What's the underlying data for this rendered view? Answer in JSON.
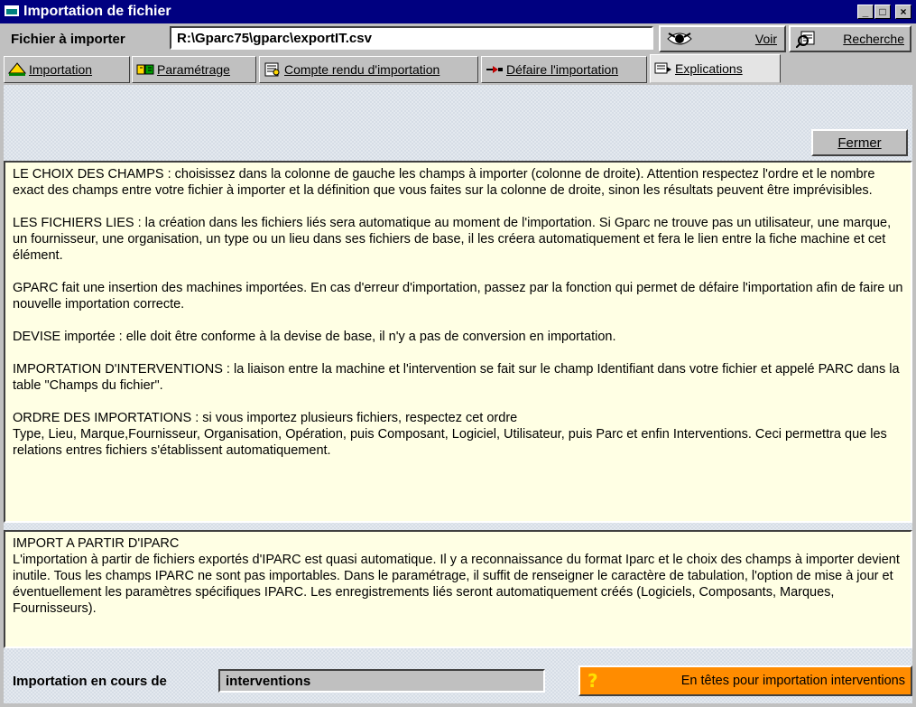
{
  "window": {
    "title": "Importation de fichier",
    "minimize": "_",
    "maximize": "□",
    "close": "×"
  },
  "file": {
    "label": "Fichier à importer",
    "value": "R:\\Gparc75\\gparc\\exportIT.csv",
    "view_button": "Voir",
    "search_button": "Recherche"
  },
  "tabs": [
    {
      "label": "Importation",
      "icon": "import-icon"
    },
    {
      "label": "Paramétrage",
      "icon": "settings-icon"
    },
    {
      "label": "Compte rendu d'importation",
      "icon": "report-icon"
    },
    {
      "label": "Défaire l'importation",
      "icon": "undo-icon"
    },
    {
      "label": "Explications",
      "icon": "help-icon",
      "active": true
    }
  ],
  "close_button": "Fermer",
  "explanations": [
    "LE CHOIX DES CHAMPS : choisissez dans la colonne de gauche les champs à importer (colonne de droite). Attention respectez l'ordre et le nombre exact des champs entre votre fichier à importer et la définition que vous faites sur la colonne de droite, sinon les résultats peuvent être imprévisibles.",
    "LES FICHIERS LIES : la création dans les fichiers liés sera automatique au moment de l'importation. Si Gparc ne trouve pas un utilisateur, une marque, un fournisseur, une organisation, un type ou un lieu dans ses fichiers de base, il les créera automatiquement et fera le lien entre la fiche machine et cet élément.",
    "GPARC fait une insertion des machines importées. En cas d'erreur d'importation, passez par la fonction qui permet de défaire l'importation afin de faire un nouvelle importation correcte.",
    "DEVISE importée : elle doit être conforme à la devise de base, il n'y a pas de conversion en importation.",
    "IMPORTATION D'INTERVENTIONS : la liaison entre la machine et l'intervention se fait sur le champ Identifiant dans votre fichier et appelé PARC dans la table \"Champs du fichier\".",
    "ORDRE DES IMPORTATIONS : si vous importez plusieurs fichiers, respectez cet ordre\nType, Lieu, Marque,Fournisseur, Organisation, Opération, puis Composant, Logiciel, Utilisateur, puis Parc et enfin Interventions. Ceci permettra que les relations entres fichiers s'établissent automatiquement."
  ],
  "iparc": {
    "heading": "IMPORT A PARTIR D'IPARC",
    "text": "L'importation à partir de fichiers exportés d'IPARC est quasi automatique. Il y a reconnaissance du format Iparc et le choix des champs à importer devient inutile. Tous les champs IPARC ne sont pas importables. Dans le paramétrage, il suffit de renseigner le caractère de tabulation, l'option de mise à jour et éventuellement les paramètres spécifiques IPARC. Les enregistrements liés seront automatiquement créés (Logiciels, Composants, Marques, Fournisseurs)."
  },
  "status": {
    "label": "Importation en cours de",
    "value": "interventions",
    "headers_button": "En têtes pour importation interventions",
    "headers_button_color": "#ff8c00"
  }
}
